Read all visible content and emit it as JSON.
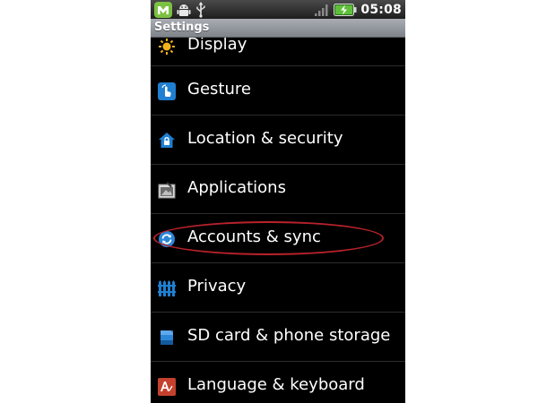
{
  "status_bar": {
    "time": "05:08",
    "icons": [
      "meebo-notification-icon",
      "android-debug-icon",
      "usb-icon",
      "signal-icon",
      "battery-charging-icon"
    ]
  },
  "header": {
    "title": "Settings"
  },
  "settings": {
    "items": [
      {
        "label": "Display",
        "icon": "display-icon"
      },
      {
        "label": "Gesture",
        "icon": "gesture-icon"
      },
      {
        "label": "Location & security",
        "icon": "location-security-icon"
      },
      {
        "label": "Applications",
        "icon": "applications-icon"
      },
      {
        "label": "Accounts & sync",
        "icon": "accounts-sync-icon"
      },
      {
        "label": "Privacy",
        "icon": "privacy-icon"
      },
      {
        "label": "SD card & phone storage",
        "icon": "sd-card-icon"
      },
      {
        "label": "Language & keyboard",
        "icon": "language-keyboard-icon"
      }
    ]
  },
  "colors": {
    "highlight": "#b8222b",
    "list_background": "#000000",
    "title_bar": "#9a9ea4"
  }
}
